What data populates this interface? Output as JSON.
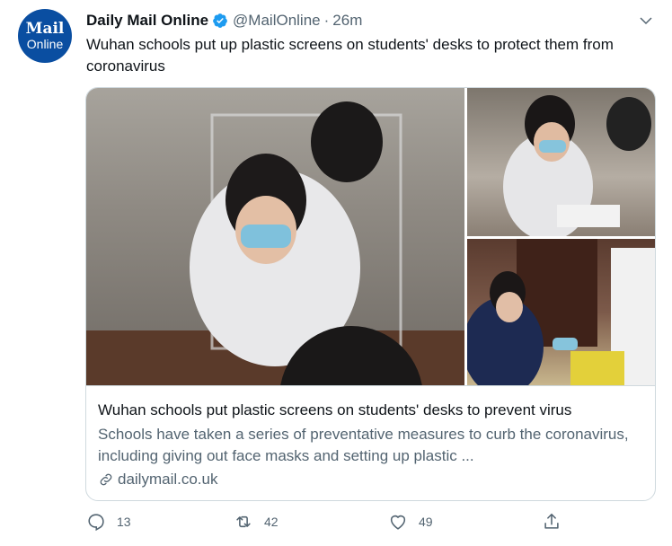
{
  "tweet": {
    "avatar": {
      "line1": "Mail",
      "line2": "Online"
    },
    "display_name": "Daily Mail Online",
    "handle": "@MailOnline",
    "separator": "·",
    "time": "26m",
    "text": "Wuhan schools put up plastic screens on students' desks to protect them from coronavirus"
  },
  "card": {
    "title": "Wuhan schools put plastic screens on students' desks to prevent virus",
    "description": "Schools have taken a series of preventative measures to curb the coronavirus, including giving out face masks and setting up plastic ...",
    "domain": "dailymail.co.uk"
  },
  "actions": {
    "reply_count": "13",
    "retweet_count": "42",
    "like_count": "49"
  },
  "colors": {
    "avatar": "#0a4ea1",
    "verified": "#1d9bf0",
    "secondary_text": "#536471",
    "border": "#cfd9de"
  },
  "icons": [
    "verified-badge-icon",
    "chevron-down-icon",
    "link-icon",
    "reply-icon",
    "retweet-icon",
    "like-icon",
    "share-icon"
  ]
}
